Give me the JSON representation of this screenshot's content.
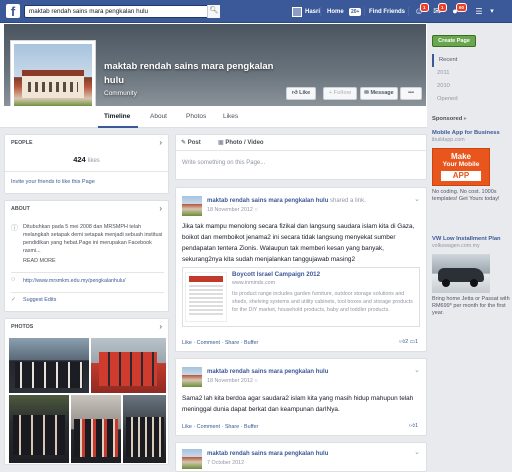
{
  "topbar": {
    "search_value": "maktab rendah sains mara pengkalan hulu",
    "user_name": "Hasri",
    "home_label": "Home",
    "home_badge": "20+",
    "find_friends_label": "Find Friends",
    "friend_requests_badge": "1",
    "messages_badge": "1",
    "notifications_badge": "60"
  },
  "page": {
    "name": "maktab rendah sains mara pengkalan hulu",
    "category": "Community",
    "like_button": "Like",
    "follow_button": "Follow",
    "message_button": "Message",
    "more_button": "•••"
  },
  "tabs": [
    "Timeline",
    "About",
    "Photos",
    "Likes"
  ],
  "left": {
    "people_title": "PEOPLE",
    "likes_count": "424",
    "likes_word": "likes",
    "invite_text": "Invite your friends to like this Page",
    "about_title": "ABOUT",
    "about_text": "Ditubuhkan pada 5 mei 2008 dan MRSMPH telah melangkah setapak demi setapak menjadi sebuah institusi pendidikan yang hebat.Page ini merupakan Facebook rasmi...",
    "read_more": "READ MORE",
    "website": "http://www.mrsmkm.edu.my/pengkalanhulu/",
    "suggest_edits": "Suggest Edits",
    "photos_title": "PHOTOS"
  },
  "composer": {
    "post_tab": "Post",
    "photo_tab": "Photo / Video",
    "placeholder": "Write something on this Page..."
  },
  "post1": {
    "author": "maktab rendah sains mara pengkalan hulu",
    "shared": "shared a link.",
    "date": "18 November 2012",
    "body": "Jika tak mampu menolong secara fizikal dan langsung saudara islam kita di Gaza, boikot dan memboikot jenama2 ini secara tidak langsung menyekat sumber pendapatan tentera Zionis. Walaupun tak memberi kesan yang banyak, sekurang2nya kita sudah menjalankan tanggujawab masing2",
    "link_title": "Boycott Israel Campaign 2012",
    "link_domain": "www.inminds.com",
    "link_desc": "Its product range includes garden furniture, outdoor storage solutions and sheds, shelving systems and utility cabinets, tool boxes and storage products for the DIY market, household products, baby and toddler products.",
    "actions": "Like · Comment · Share · Buffer",
    "likes": "2",
    "comments": "1"
  },
  "post2": {
    "author": "maktab rendah sains mara pengkalan hulu",
    "date": "18 November 2012",
    "body": "Sama2 lah kita berdoa agar saudara2 islam kita yang masih hidup mahupun telah meninggal dunia dapat berkat dan keampunan darINya.",
    "actions": "Like · Comment · Share · Buffer",
    "likes": "1"
  },
  "post3": {
    "author": "maktab rendah sains mara pengkalan hulu",
    "date": "7 October 2012"
  },
  "right": {
    "create_page": "Create Page",
    "years": [
      "Recent",
      "2011",
      "2010",
      "Opened"
    ],
    "sponsored": "Sponsored",
    "ad1_title": "Mobile App for Business",
    "ad1_url": "ibuildapp.com",
    "ad1_img_l1": "Make",
    "ad1_img_l2": "Your Mobile",
    "ad1_img_l3": "APP",
    "ad1_text": "No coding. No cost. 1000s templates! Get Yours today!",
    "ad2_title": "VW Low Installment Plan",
    "ad2_url": "volkswagen.com.my",
    "ad2_text": "Bring home Jetta or Passat with RM699* per month for the first year."
  },
  "colors": {
    "fb_blue": "#3b5998",
    "background": "#e9eaed",
    "create_green": "#69a74e",
    "ad_orange": "#e8561e"
  }
}
